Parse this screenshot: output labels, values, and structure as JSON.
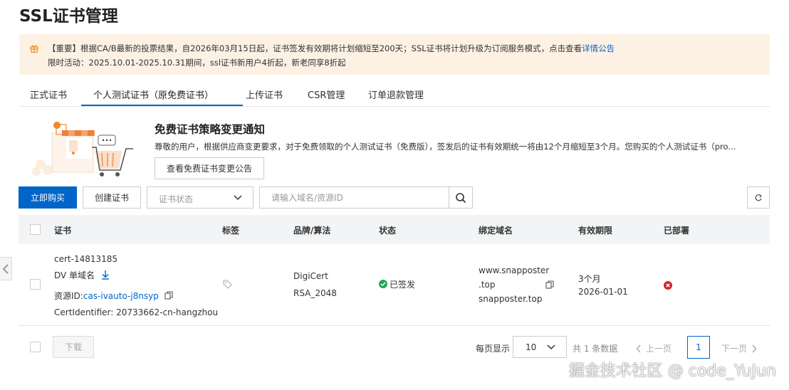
{
  "page": {
    "title": "SSL证书管理"
  },
  "notice": {
    "line1_text": "【重要】根据CA/B最新的投票结果，自2026年03月15日起，证书签发有效期将计划缩短至200天；SSL证书将计划升级为订阅服务模式，点击查看",
    "line1_link": "详情公告",
    "line2": "限时活动：2025.10.01-2025.10.31期间，ssl证书新用户4折起，新老同享8折起"
  },
  "tabs": [
    {
      "label": "正式证书"
    },
    {
      "label": "个人测试证书（原免费证书）",
      "active": true
    },
    {
      "label": "上传证书"
    },
    {
      "label": "CSR管理"
    },
    {
      "label": "订单退款管理"
    }
  ],
  "promo": {
    "title": "免费证书策略变更通知",
    "text": "尊敬的用户，根据供应商变更要求，对于免费领取的个人测试证书（免费版），签发后的证书有效期统一将由12个月缩短至3个月。您购买的个人测试证书（pro...",
    "button": "查看免费证书变更公告"
  },
  "toolbar": {
    "buy": "立即购买",
    "create": "创建证书",
    "status_placeholder": "证书状态",
    "search_placeholder": "请输入域名/资源ID"
  },
  "table": {
    "headers": {
      "cert": "证书",
      "tag": "标签",
      "brand": "品牌/算法",
      "status": "状态",
      "domain": "绑定域名",
      "validity": "有效期限",
      "deployed": "已部署"
    },
    "rows": [
      {
        "name": "cert-14813185",
        "type": "DV 单域名",
        "resource_prefix": "资源ID:",
        "resource_id": "cas-ivauto-j8nsyp",
        "cert_identifier": "CertIdentifier: 20733662-cn-hangzhou",
        "brand": "DigiCert",
        "algorithm": "RSA_2048",
        "status": "已签发",
        "domain_line1": "www.snapposter",
        "domain_line2": ".top",
        "domain_line3": "snapposter.top",
        "validity_period": "3个月",
        "validity_date": "2026-01-01"
      }
    ]
  },
  "footer": {
    "download": "下载",
    "per_page_label": "每页显示",
    "per_page": "10",
    "total": "共 1 条数据",
    "prev": "上一页",
    "current_page": "1",
    "next": "下一页"
  },
  "watermark": "掘金技术社区 @ code_YuJun",
  "colors": {
    "primary": "#0064c8",
    "notice_bg": "#fdf1e4",
    "success": "#22a55b",
    "error": "#d9202d"
  }
}
